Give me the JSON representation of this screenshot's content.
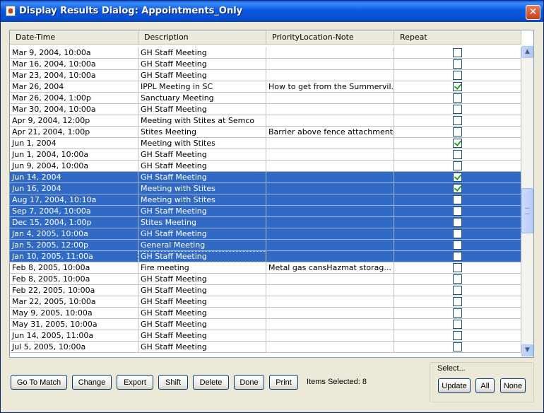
{
  "window": {
    "title": "Display Results Dialog: Appointments_Only",
    "close_glyph": "✕"
  },
  "table": {
    "columns": [
      "Date-Time",
      "Description",
      "PriorityLocation-Note",
      "Repeat"
    ],
    "rows": [
      {
        "date": "Mar 9, 2004, 10:00a",
        "desc": "GH Staff Meeting",
        "note": "",
        "repeat": false,
        "selected": false
      },
      {
        "date": "Mar 16, 2004, 10:00a",
        "desc": "GH Staff Meeting",
        "note": "",
        "repeat": false,
        "selected": false
      },
      {
        "date": "Mar 23, 2004, 10:00a",
        "desc": "GH Staff Meeting",
        "note": "",
        "repeat": false,
        "selected": false
      },
      {
        "date": "Mar 26, 2004",
        "desc": "IPPL Meeting in SC",
        "note": "How to get from the Summervil...",
        "repeat": true,
        "selected": false
      },
      {
        "date": "Mar 26, 2004, 1:00p",
        "desc": "Sanctuary Meeting",
        "note": "",
        "repeat": false,
        "selected": false
      },
      {
        "date": "Mar 30, 2004, 10:00a",
        "desc": "GH Staff Meeting",
        "note": "",
        "repeat": false,
        "selected": false
      },
      {
        "date": "Apr 9, 2004, 12:00p",
        "desc": "Meeting with Stites at Semco",
        "note": "",
        "repeat": false,
        "selected": false
      },
      {
        "date": "Apr 21, 2004, 1:00p",
        "desc": "Stites Meeting",
        "note": "Barrier above fence attachments",
        "repeat": false,
        "selected": false
      },
      {
        "date": "Jun 1, 2004",
        "desc": "Meeting with Stites",
        "note": "",
        "repeat": true,
        "selected": false
      },
      {
        "date": "Jun 1, 2004, 10:00a",
        "desc": "GH Staff Meeting",
        "note": "",
        "repeat": false,
        "selected": false
      },
      {
        "date": "Jun 9, 2004, 10:00a",
        "desc": "GH Staff Meeting",
        "note": "",
        "repeat": false,
        "selected": false
      },
      {
        "date": "Jun 14, 2004",
        "desc": "GH Staff Meeting",
        "note": "",
        "repeat": true,
        "selected": true
      },
      {
        "date": "Jun 16, 2004",
        "desc": "Meeting with Stites",
        "note": "",
        "repeat": true,
        "selected": true
      },
      {
        "date": "Aug 17, 2004, 10:10a",
        "desc": "Meeting with Stites",
        "note": "",
        "repeat": false,
        "selected": true
      },
      {
        "date": "Sep 7, 2004, 10:00a",
        "desc": "GH Staff Meeting",
        "note": "",
        "repeat": false,
        "selected": true
      },
      {
        "date": "Dec 15, 2004, 1:00p",
        "desc": "Stites Meeting",
        "note": "",
        "repeat": false,
        "selected": true
      },
      {
        "date": "Jan 4, 2005, 10:00a",
        "desc": "GH Staff Meeting",
        "note": "",
        "repeat": false,
        "selected": true
      },
      {
        "date": "Jan 5, 2005, 12:00p",
        "desc": "General  Meeting",
        "note": "",
        "repeat": false,
        "selected": true
      },
      {
        "date": "Jan 10, 2005, 11:00a",
        "desc": "GH Staff Meeting",
        "note": "",
        "repeat": false,
        "selected": true,
        "focused": true
      },
      {
        "date": "Feb 8, 2005, 10:00a",
        "desc": "Fire meeting",
        "note": "Metal gas cansHazmat storag...",
        "repeat": false,
        "selected": false
      },
      {
        "date": "Feb 8, 2005, 10:00a",
        "desc": "GH Staff Meeting",
        "note": "",
        "repeat": false,
        "selected": false
      },
      {
        "date": "Feb 22, 2005, 10:00a",
        "desc": "GH Staff Meeting",
        "note": "",
        "repeat": false,
        "selected": false
      },
      {
        "date": "Mar 22, 2005, 10:00a",
        "desc": "GH Staff Meeting",
        "note": "",
        "repeat": false,
        "selected": false
      },
      {
        "date": "May 9, 2005, 10:00a",
        "desc": "GH Staff Meeting",
        "note": "",
        "repeat": false,
        "selected": false
      },
      {
        "date": "May 31, 2005, 10:00a",
        "desc": "GH Staff Meeting",
        "note": "",
        "repeat": false,
        "selected": false
      },
      {
        "date": "Jun 14, 2005, 11:00a",
        "desc": "GH Staff Meeting",
        "note": "",
        "repeat": false,
        "selected": false
      },
      {
        "date": "Jul 5, 2005, 10:00a",
        "desc": "GH Staff Meeting",
        "note": "",
        "repeat": false,
        "selected": false
      }
    ]
  },
  "scrollbar": {
    "up_glyph": "▲",
    "down_glyph": "▼"
  },
  "buttons": {
    "go_to_match": "Go To Match",
    "change": "Change",
    "export": "Export",
    "shift": "Shift",
    "delete": "Delete",
    "done": "Done",
    "print": "Print"
  },
  "items_selected": "Items Selected: 8",
  "select_group": {
    "label": "Select...",
    "update": "Update",
    "all": "All",
    "none": "None"
  }
}
